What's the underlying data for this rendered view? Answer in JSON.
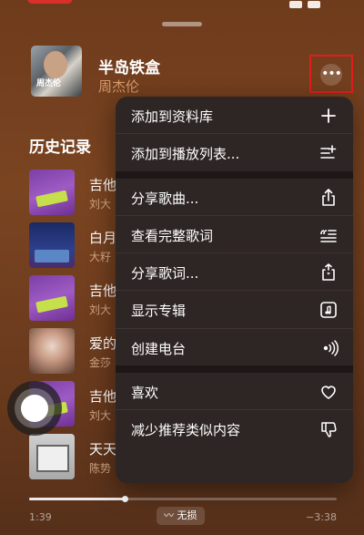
{
  "now_playing": {
    "title": "半岛铁盒",
    "artist": "周杰伦",
    "art_text": "周杰伦"
  },
  "history": {
    "heading": "历史记录",
    "items": [
      {
        "title": "吉他",
        "artist": "刘大"
      },
      {
        "title": "白月",
        "artist": "大籽"
      },
      {
        "title": "吉他",
        "artist": "刘大"
      },
      {
        "title": "爱的",
        "artist": "金莎"
      },
      {
        "title": "吉他",
        "artist": "刘大"
      },
      {
        "title": "天天",
        "artist": "陈势"
      }
    ]
  },
  "menu": {
    "items": [
      {
        "label": "添加到资料库",
        "icon": "plus-icon"
      },
      {
        "label": "添加到播放列表...",
        "icon": "add-to-playlist-icon"
      },
      {
        "label": "分享歌曲...",
        "icon": "share-icon"
      },
      {
        "label": "查看完整歌词",
        "icon": "lyrics-icon"
      },
      {
        "label": "分享歌词...",
        "icon": "share-lyrics-icon"
      },
      {
        "label": "显示专辑",
        "icon": "album-icon"
      },
      {
        "label": "创建电台",
        "icon": "radio-icon"
      },
      {
        "label": "喜欢",
        "icon": "heart-icon"
      },
      {
        "label": "减少推荐类似内容",
        "icon": "thumbs-down-icon"
      }
    ]
  },
  "player": {
    "elapsed": "1:39",
    "remaining": "−3:38",
    "lossless_label": "无损",
    "progress": 0.31
  },
  "colors": {
    "highlight_box": "#e11d1d",
    "artist": "#d99a6a"
  }
}
